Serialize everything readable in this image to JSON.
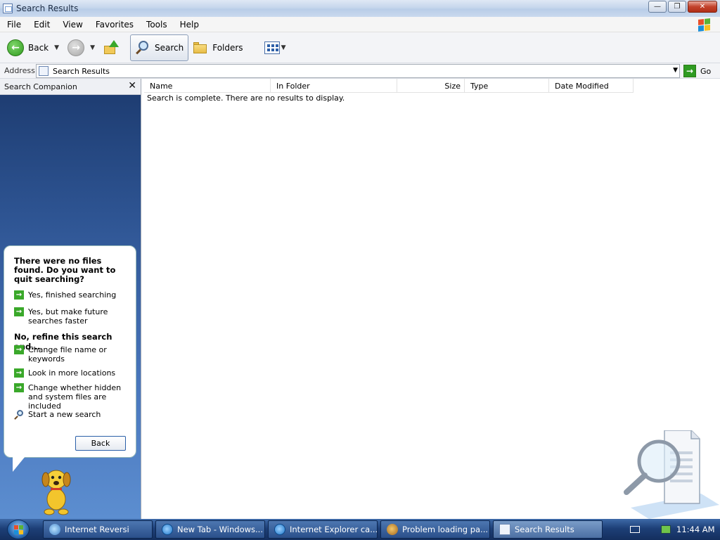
{
  "window": {
    "title": "Search Results"
  },
  "window_buttons": [
    "minimize",
    "restore",
    "close"
  ],
  "menu": [
    "File",
    "Edit",
    "View",
    "Favorites",
    "Tools",
    "Help"
  ],
  "toolbar": {
    "back_label": "Back",
    "search_label": "Search",
    "folders_label": "Folders"
  },
  "address": {
    "label": "Address",
    "value": "Search Results",
    "go_label": "Go"
  },
  "search_companion": {
    "header": "Search Companion",
    "title": "There were no files found. Do you want to quit searching?",
    "quit_options": [
      "Yes, finished searching",
      "Yes, but make future searches faster"
    ],
    "refine_heading": "No, refine this search and...",
    "refine_options": [
      "Change file name or keywords",
      "Look in more locations",
      "Change whether hidden and system files are included"
    ],
    "new_search": "Start a new search",
    "back_button": "Back"
  },
  "results": {
    "columns": [
      "Name",
      "In Folder",
      "Size",
      "Type",
      "Date Modified"
    ],
    "message": "Search is complete. There are no results to display."
  },
  "taskbar": {
    "tasks": [
      {
        "label": "Internet Reversi",
        "icon": "globe-icon"
      },
      {
        "label": "New Tab - Windows...",
        "icon": "ie-icon"
      },
      {
        "label": "Internet Explorer ca...",
        "icon": "ie-icon"
      },
      {
        "label": "Problem loading pa...",
        "icon": "firefox-icon"
      },
      {
        "label": "Search Results",
        "icon": "explorer-icon",
        "active": true
      }
    ],
    "clock": "11:44 AM"
  }
}
